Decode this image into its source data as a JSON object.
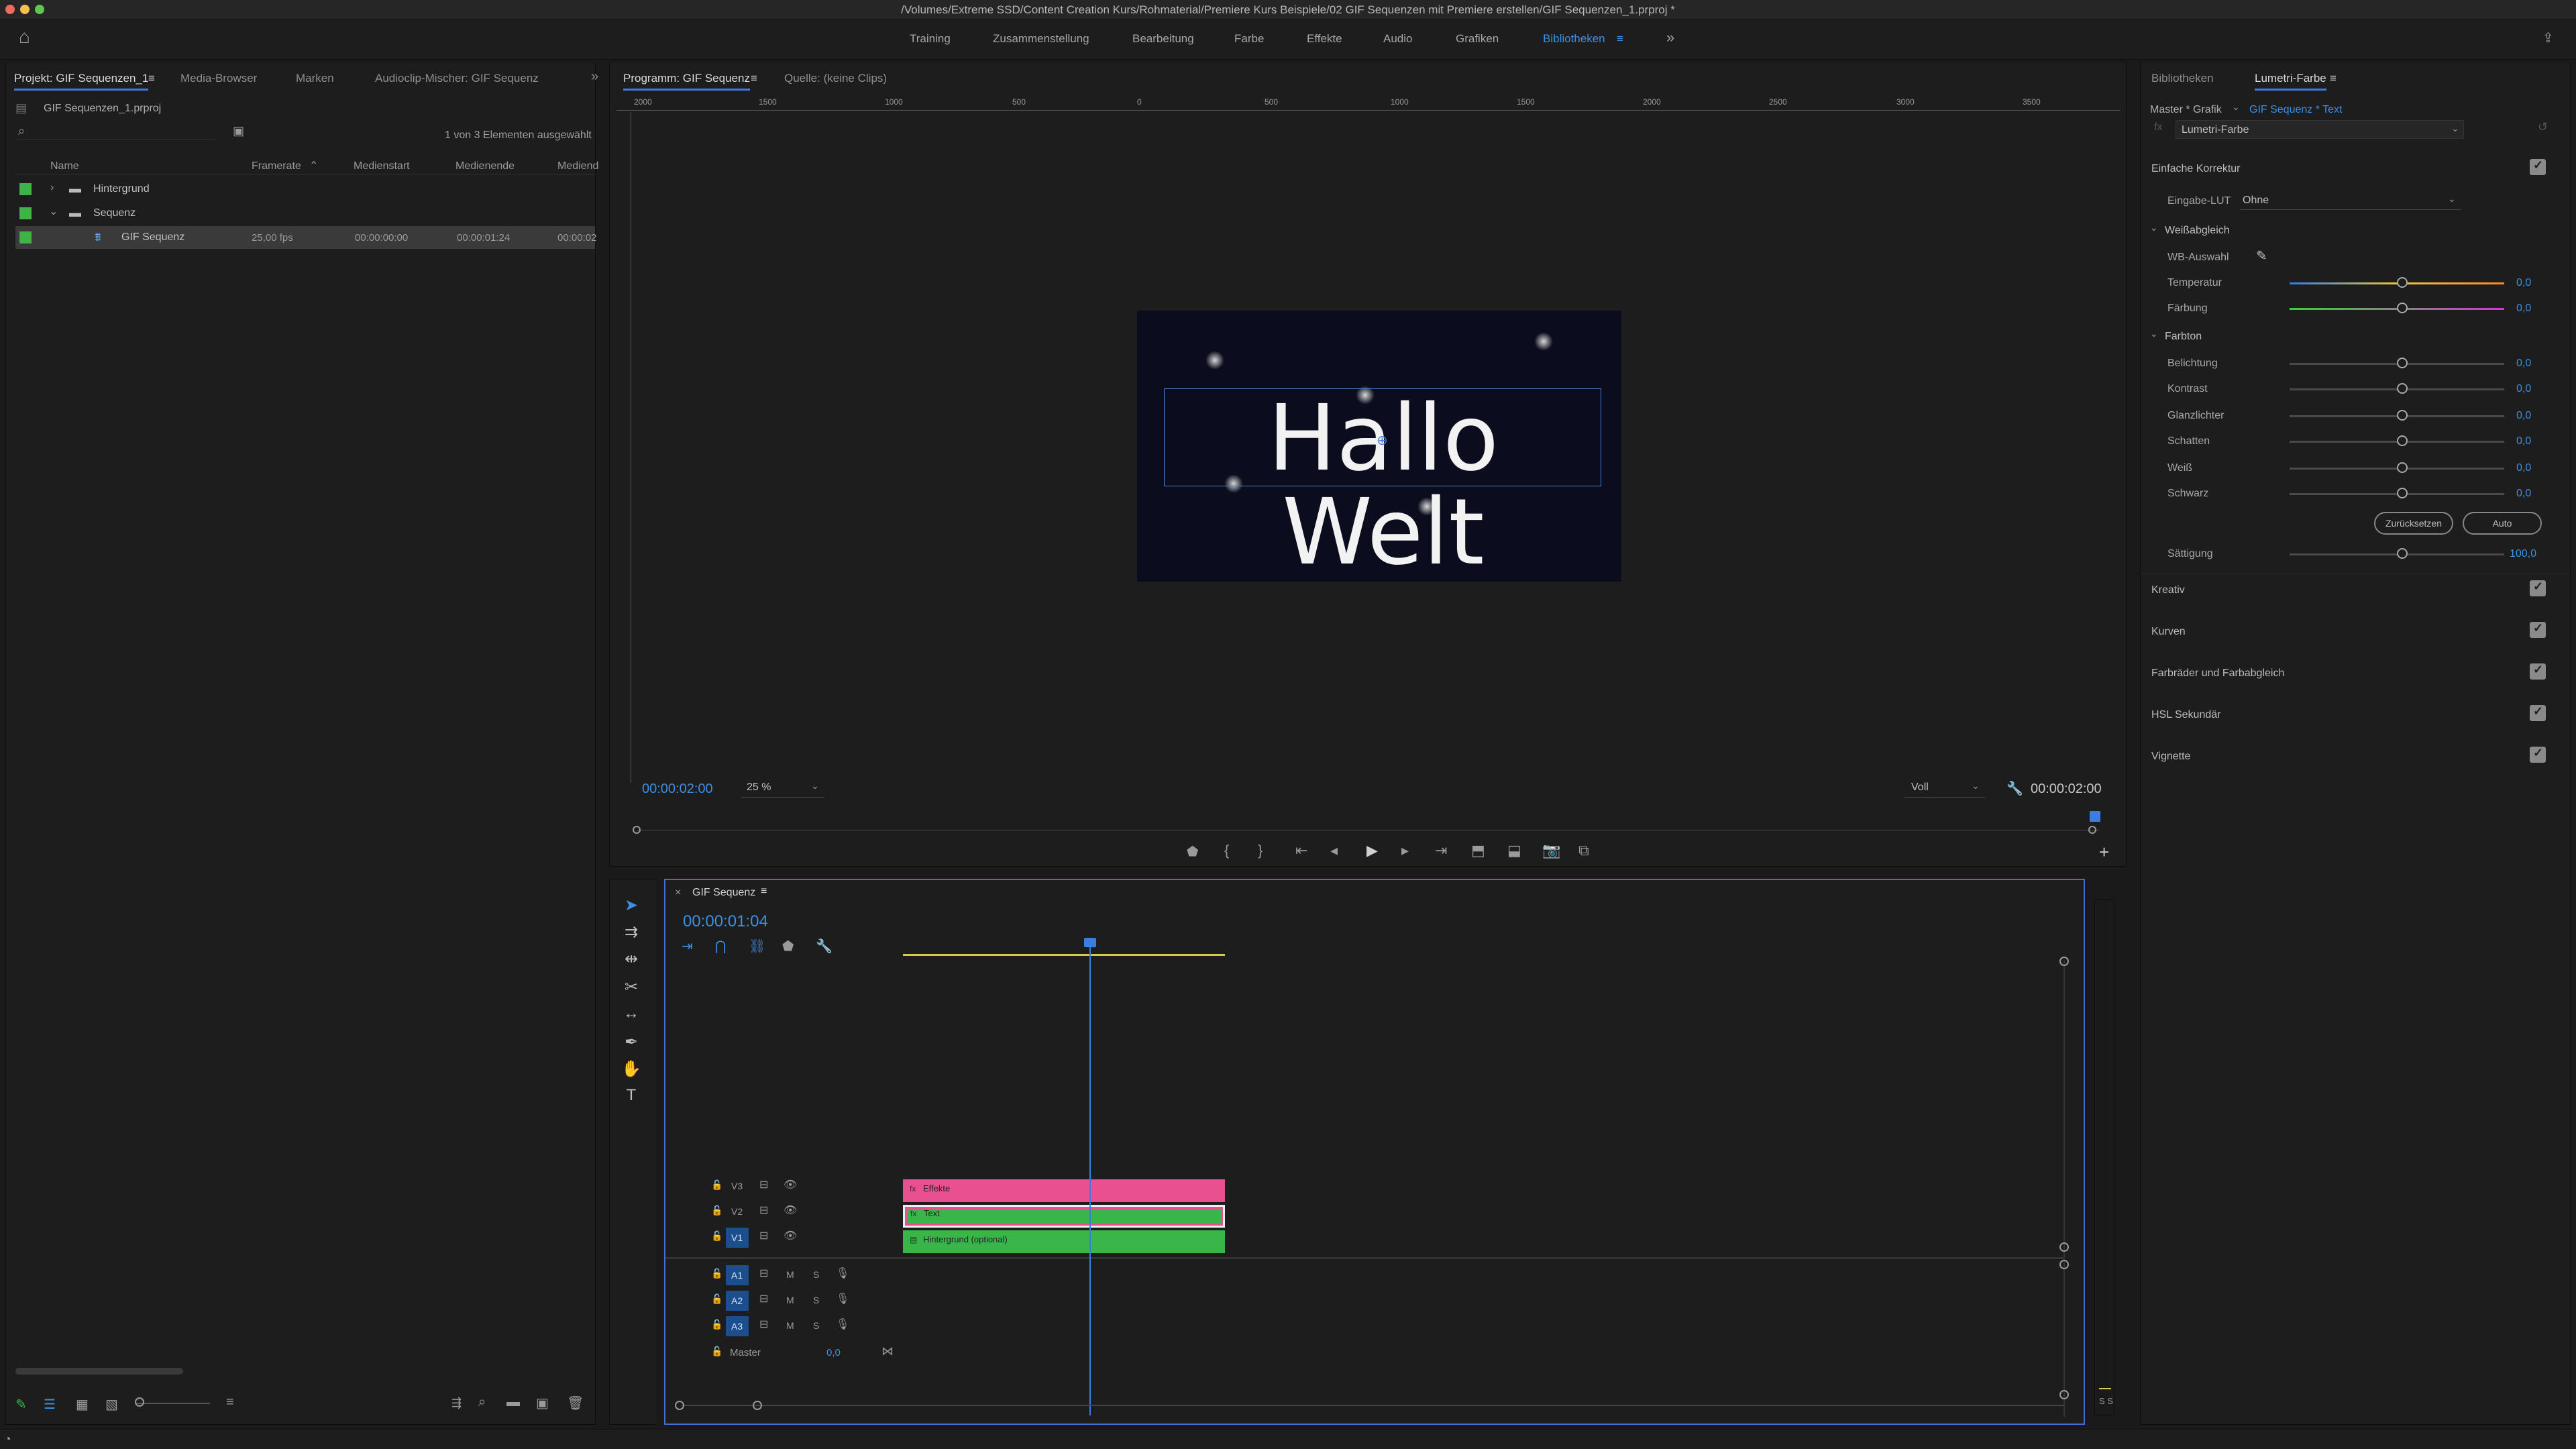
{
  "window_title": "/Volumes/Extreme SSD/Content Creation Kurs/Rohmaterial/Premiere Kurs Beispiele/02 GIF Sequenzen mit Premiere erstellen/GIF Sequenzen_1.prproj *",
  "workspaces": [
    {
      "label": "Training"
    },
    {
      "label": "Zusammenstellung"
    },
    {
      "label": "Bearbeitung"
    },
    {
      "label": "Farbe"
    },
    {
      "label": "Effekte"
    },
    {
      "label": "Audio"
    },
    {
      "label": "Grafiken"
    },
    {
      "label": "Bibliotheken"
    }
  ],
  "colors": {
    "accent": "#3d8fe6",
    "pink_clip": "#e8508f",
    "green_clip": "#39b54a",
    "panel_bg": "#1d1d1d",
    "monitor_bg": "#0b0c1d",
    "playhead": "#3d7de0"
  },
  "project_panel": {
    "tabs": [
      "Projekt: GIF Sequenzen_1",
      "Media-Browser",
      "Marken",
      "Audioclip-Mischer: GIF Sequenz"
    ],
    "project_file": "GIF Sequenzen_1.prproj",
    "selection_status": "1 von 3 Elementen ausgewählt",
    "columns": [
      "Name",
      "Framerate",
      "Medienstart",
      "Medienende",
      "Mediend"
    ],
    "items": [
      {
        "name": "Hintergrund",
        "framerate": "",
        "start": "",
        "end": "",
        "dur": ""
      },
      {
        "name": "Sequenz",
        "framerate": "",
        "start": "",
        "end": "",
        "dur": ""
      },
      {
        "name": "GIF Sequenz",
        "framerate": "25,00 fps",
        "start": "00:00:00:00",
        "end": "00:00:01:24",
        "dur": "00:00:02"
      }
    ]
  },
  "program_monitor": {
    "tabs": [
      "Programm: GIF Sequenz",
      "Quelle: (keine Clips)"
    ],
    "ruler_labels": [
      "2000",
      "1500",
      "1000",
      "500",
      "0",
      "500",
      "1000",
      "1500",
      "2000",
      "2500",
      "3000",
      "3500"
    ],
    "overlay_text": "Hallo Welt",
    "timecode": "00:00:02:00",
    "zoom": "25 %",
    "quality": "Voll",
    "duration": "00:00:02:00"
  },
  "timeline": {
    "tab": "GIF Sequenz",
    "timecode": "00:00:01:04",
    "video_tracks": [
      {
        "label": "V3",
        "clip": "Effekte"
      },
      {
        "label": "V2",
        "clip": "Text"
      },
      {
        "label": "V1",
        "clip": "Hintergrund (optional)"
      }
    ],
    "audio_tracks": [
      {
        "label": "A1",
        "m": "M",
        "s": "S"
      },
      {
        "label": "A2",
        "m": "M",
        "s": "S"
      },
      {
        "label": "A3",
        "m": "M",
        "s": "S"
      }
    ],
    "master": {
      "label": "Master",
      "value": "0,0"
    },
    "meter_label": "S S"
  },
  "lumetri": {
    "tabs": [
      "Bibliotheken",
      "Lumetri-Farbe"
    ],
    "master_label": "Master * Grafik",
    "target": "GIF Sequenz * Text",
    "effect_select": "Lumetri-Farbe",
    "section_basic": "Einfache Korrektur",
    "input_lut_label": "Eingabe-LUT",
    "input_lut_value": "Ohne",
    "wb_header": "Weißabgleich",
    "wb_picker": "WB-Auswahl",
    "sliders_wb": [
      {
        "label": "Temperatur",
        "value": "0,0"
      },
      {
        "label": "Färbung",
        "value": "0,0"
      }
    ],
    "tone_header": "Farbton",
    "sliders_tone": [
      {
        "label": "Belichtung",
        "value": "0,0"
      },
      {
        "label": "Kontrast",
        "value": "0,0"
      },
      {
        "label": "Glanzlichter",
        "value": "0,0"
      },
      {
        "label": "Schatten",
        "value": "0,0"
      },
      {
        "label": "Weiß",
        "value": "0,0"
      },
      {
        "label": "Schwarz",
        "value": "0,0"
      }
    ],
    "reset_button": "Zurücksetzen",
    "auto_button": "Auto",
    "saturation": {
      "label": "Sättigung",
      "value": "100,0"
    },
    "sections": [
      "Kreativ",
      "Kurven",
      "Farbräder und Farbabgleich",
      "HSL Sekundär",
      "Vignette"
    ]
  }
}
